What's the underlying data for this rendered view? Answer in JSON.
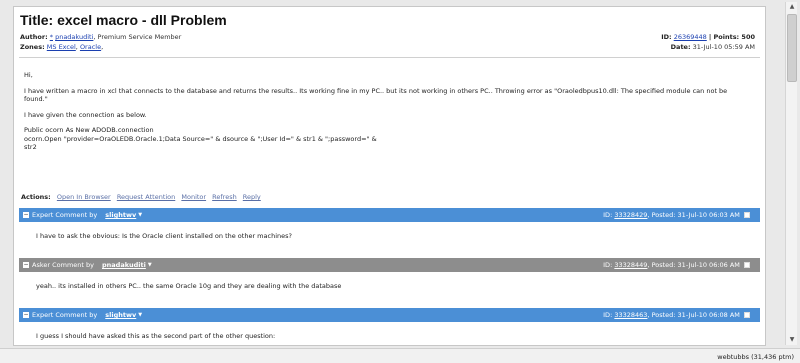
{
  "question": {
    "title": "Title: excel macro - dll Problem",
    "author_label": "Author:",
    "author_star": "*",
    "author_name": "pnadakuditi",
    "author_role": ", Premium Service Member",
    "zones_label": "Zones:",
    "zones": [
      "MS Excel",
      "Oracle"
    ],
    "id_label": "ID:",
    "id": "26369448",
    "points_label": "| Points: 500",
    "date_label": "Date:",
    "date": "31-Jul-10 05:59 AM",
    "body": {
      "greeting": "Hi,",
      "para1": "I have written a macro in xcl that connects to the database and returns the results.. Its working fine in my PC.. but its not working in others PC.. Throwing error as \"Oraoledbpus10.dll: The specified module can not be found.\"",
      "para2": "I have given the connection as below.",
      "code1": "Public ocorn As New ADODB.connection",
      "code2": "ocorn.Open \"provider=OraOLEDB.Oracle.1;Data Source=\" & dsource & \";User Id=\" & str1 & \";password=\" &",
      "code3": "str2"
    }
  },
  "actions": {
    "label": "Actions:",
    "items": [
      "Open In Browser",
      "Request Attention",
      "Monitor",
      "Refresh",
      "Reply"
    ]
  },
  "comments": [
    {
      "type": "Expert Comment by",
      "user": "slightwv",
      "id_label": "ID:",
      "id": "33328429",
      "posted": ", Posted: 31-Jul-10 06:03 AM",
      "body": "I have to ask the obvious:  Is the Oracle client installed on the other machines?"
    },
    {
      "type": "Asker Comment by",
      "user": "pnadakuditi",
      "id_label": "ID:",
      "id": "33328449",
      "posted": ", Posted: 31-Jul-10 06:06 AM",
      "body": "yeah.. its installed in others PC.. the same Oracle 10g and they are dealing with  the database"
    },
    {
      "type": "Expert Comment by",
      "user": "slightwv",
      "id_label": "ID:",
      "id": "33328463",
      "posted": ", Posted: 31-Jul-10 06:08 AM",
      "body": "I guess I should have asked this as the second part of the other question:"
    }
  ],
  "statusbar": {
    "text": "webtubbs (31,436 ptm)"
  },
  "colors": {
    "expert_header": "#4b8fd6",
    "asker_header": "#8d8d8d",
    "link": "#1a3fb0"
  }
}
